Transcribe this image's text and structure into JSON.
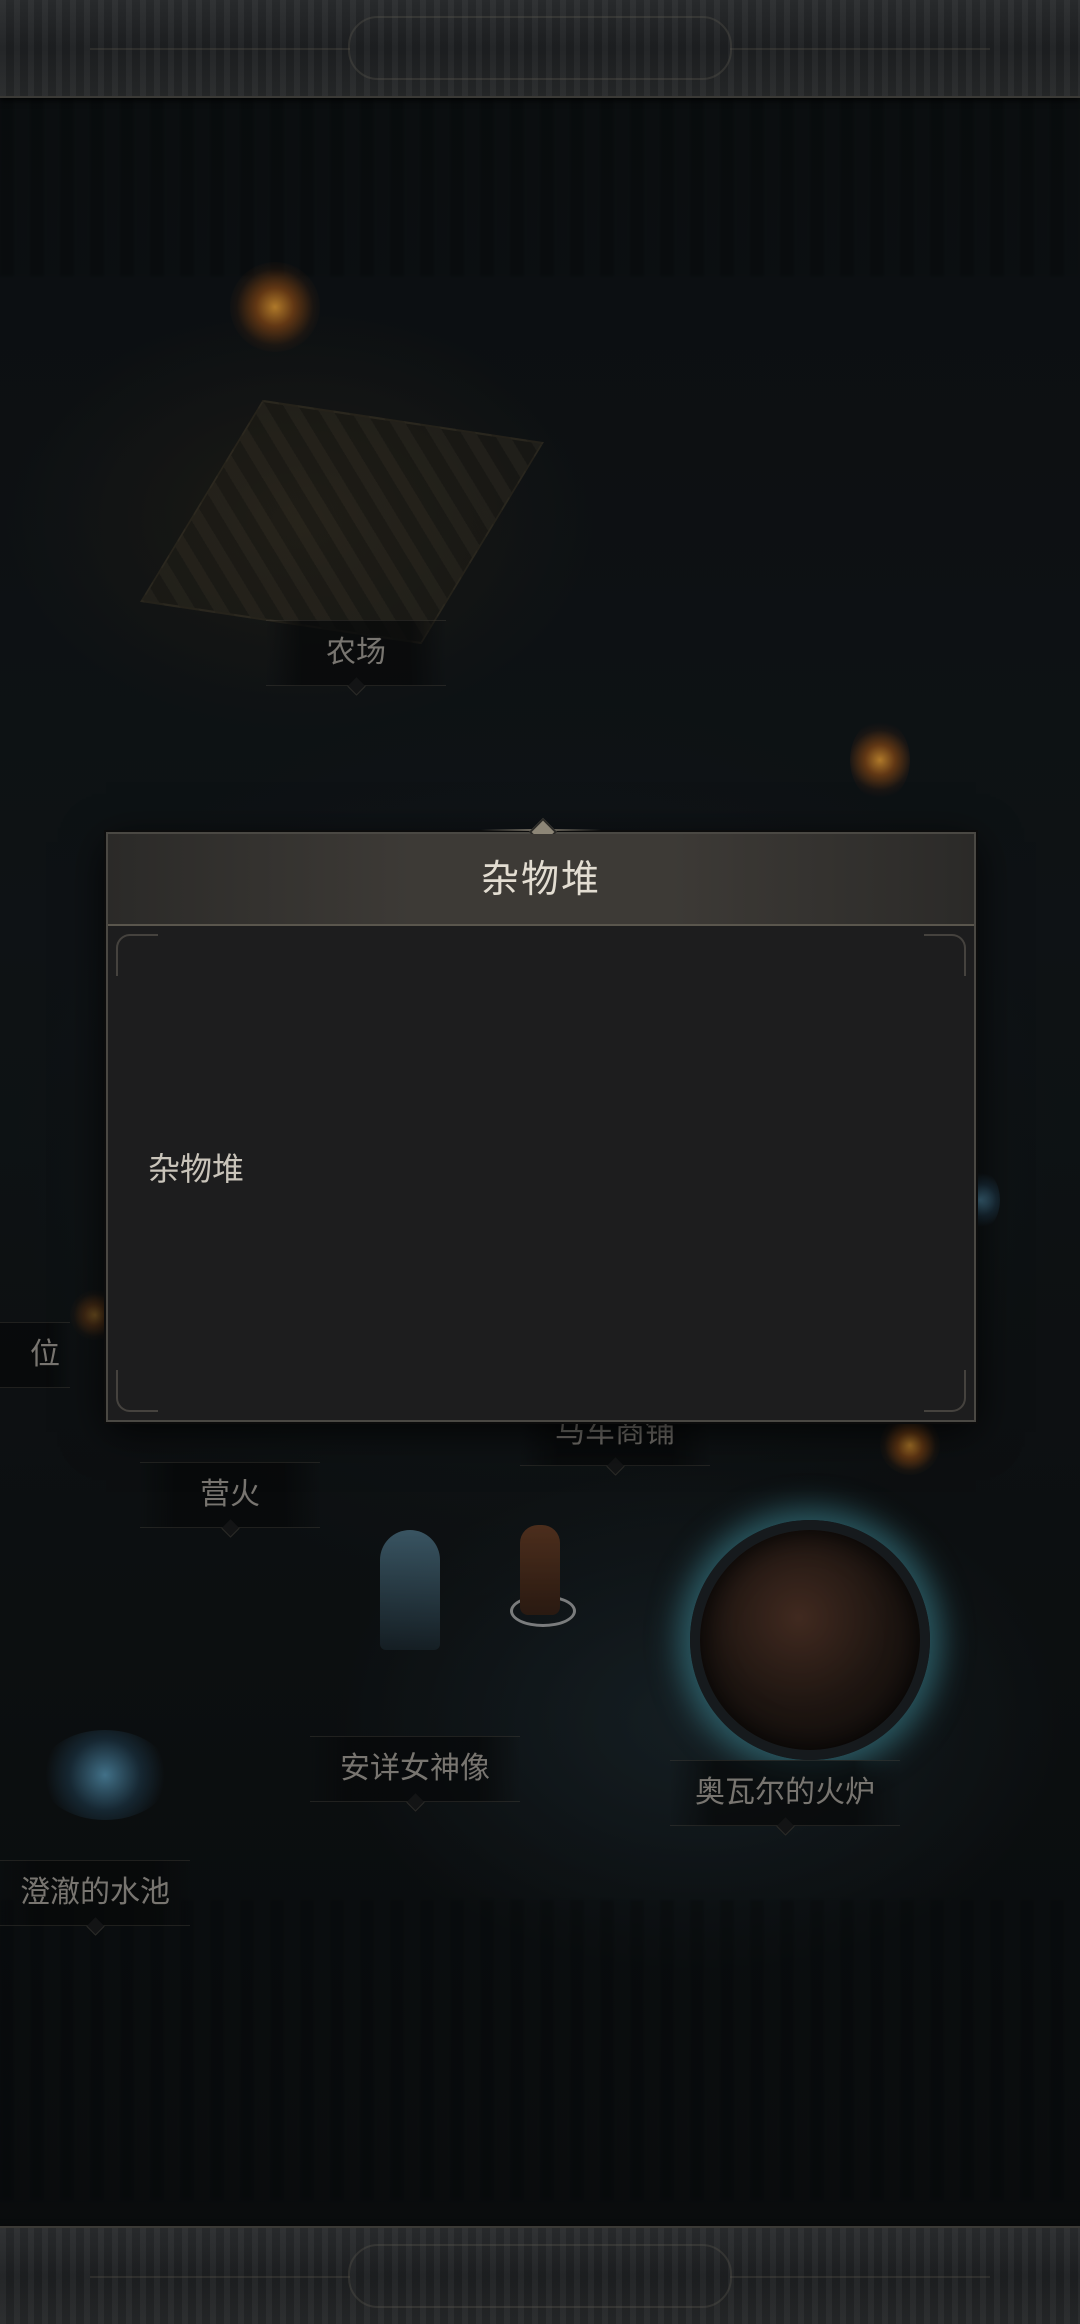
{
  "modal": {
    "title": "杂物堆",
    "description": "杂物堆"
  },
  "map": {
    "labels": {
      "farm": "农场",
      "partial_left": "位",
      "campfire": "营火",
      "cart_shop": "马车商铺",
      "tranquil_statue": "安详女神像",
      "forge": "奥瓦尔的火炉",
      "clear_pool": "澄澈的水池"
    }
  },
  "colors": {
    "modal_bg": "#1d1d1e",
    "modal_header": "#3d3a36",
    "label_text": "#a7a39c",
    "portal_glow": "#5ac8dc"
  }
}
